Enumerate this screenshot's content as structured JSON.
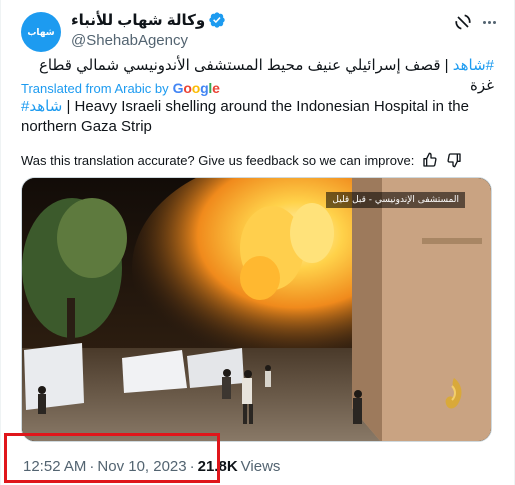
{
  "author": {
    "display_name": "وكالة شهاب للأنباء",
    "handle": "@ShehabAgency",
    "avatar_text": "شهاب"
  },
  "tweet": {
    "arabic_hashtag": "#شاهد",
    "arabic_body": "| قصف إسرائيلي عنيف محيط المستشفى الأندونيسي شمالي قطاع غزة",
    "translated_from": "Translated from Arabic by",
    "translator": "Google",
    "english_hashtag": "#شاهد",
    "english_body": "| Heavy Israeli shelling around the Indonesian Hospital in the northern Gaza Strip",
    "feedback_prompt": "Was this translation accurate? Give us feedback so we can improve:"
  },
  "media": {
    "video_caption": "المستشفى الإندونيسي - قبل قليل"
  },
  "meta": {
    "time": "12:52 AM",
    "separator": "·",
    "date": "Nov 10, 2023",
    "views_count": "21.8K",
    "views_label": "Views"
  },
  "colors": {
    "accent": "#1d9bf0",
    "text": "#0f1419",
    "muted": "#536471",
    "highlight": "#e0161b"
  },
  "icons": {
    "verified": "verified-badge-icon",
    "grok": "grok-icon",
    "more": "more-icon",
    "thumbs_up": "thumbs-up-icon",
    "thumbs_down": "thumbs-down-icon"
  }
}
